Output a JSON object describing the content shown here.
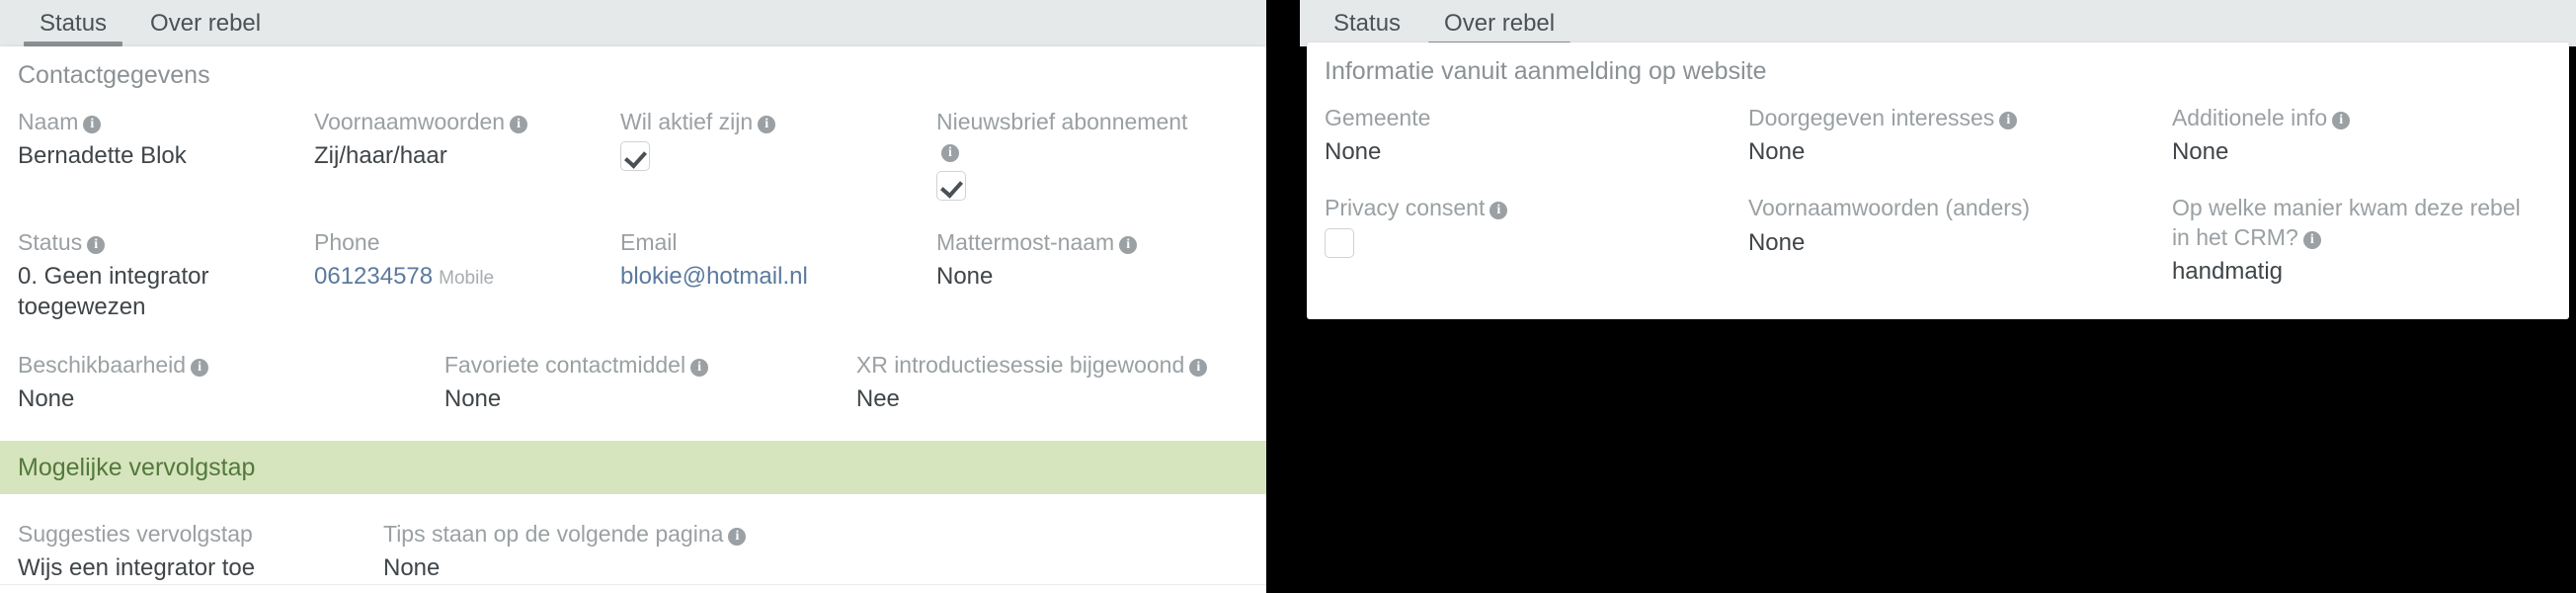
{
  "left_panel": {
    "tabs": [
      {
        "label": "Status",
        "active": true
      },
      {
        "label": "Over rebel",
        "active": false
      }
    ],
    "section_title": "Contactgegevens",
    "row1": [
      {
        "label": "Naam",
        "info": true,
        "value": "Bernadette Blok"
      },
      {
        "label": "Voornaamwoorden",
        "info": true,
        "value": "Zij/haar/haar"
      },
      {
        "label": "Wil aktief zijn",
        "info": true,
        "checkbox": "checked"
      },
      {
        "label": "Nieuwsbrief abonnement",
        "info": true,
        "checkbox": "checked"
      }
    ],
    "row2": [
      {
        "label": "Status",
        "info": true,
        "value": "0. Geen integrator toegewezen"
      },
      {
        "label": "Phone",
        "info": false,
        "value": "061234578",
        "suffix": "Mobile",
        "link": true
      },
      {
        "label": "Email",
        "info": false,
        "value": "blokie@hotmail.nl",
        "link": true
      },
      {
        "label": "Mattermost-naam",
        "info": true,
        "value": "None"
      }
    ],
    "row3": [
      {
        "label": "Beschikbaarheid",
        "info": true,
        "value": "None"
      },
      {
        "label": "Favoriete contactmiddel",
        "info": true,
        "value": "None"
      },
      {
        "label": "XR introductiesessie bijgewoond",
        "info": true,
        "value": "Nee"
      }
    ],
    "band_title": "Mogelijke vervolgstap",
    "row4": [
      {
        "label": "Suggesties vervolgstap",
        "info": false,
        "value": "Wijs een integrator toe"
      },
      {
        "label": "Tips staan op de volgende pagina",
        "info": true,
        "value": "None"
      }
    ]
  },
  "right_panel": {
    "tabs": [
      {
        "label": "Status",
        "active": false
      },
      {
        "label": "Over rebel",
        "active": true
      }
    ],
    "section_title": "Informatie vanuit aanmelding op website",
    "row1": [
      {
        "label": "Gemeente",
        "info": false,
        "value": "None"
      },
      {
        "label": "Doorgegeven interesses",
        "info": true,
        "value": "None"
      },
      {
        "label": "Additionele info",
        "info": true,
        "value": "None"
      }
    ],
    "row2": [
      {
        "label": "Privacy consent",
        "info": true,
        "checkbox": "unchecked"
      },
      {
        "label": "Voornaamwoorden (anders)",
        "info": false,
        "value": "None"
      },
      {
        "label": "Op welke manier kwam deze rebel in het CRM?",
        "info": true,
        "value": "handmatig"
      }
    ]
  },
  "icons": {
    "info": "i"
  },
  "colors": {
    "band_bg": "#d6e5bd",
    "band_text": "#53783c",
    "tabbar_bg": "#e6e9ea",
    "link": "#5b7a9c",
    "label": "#9aa0a3",
    "value": "#3f4548"
  }
}
